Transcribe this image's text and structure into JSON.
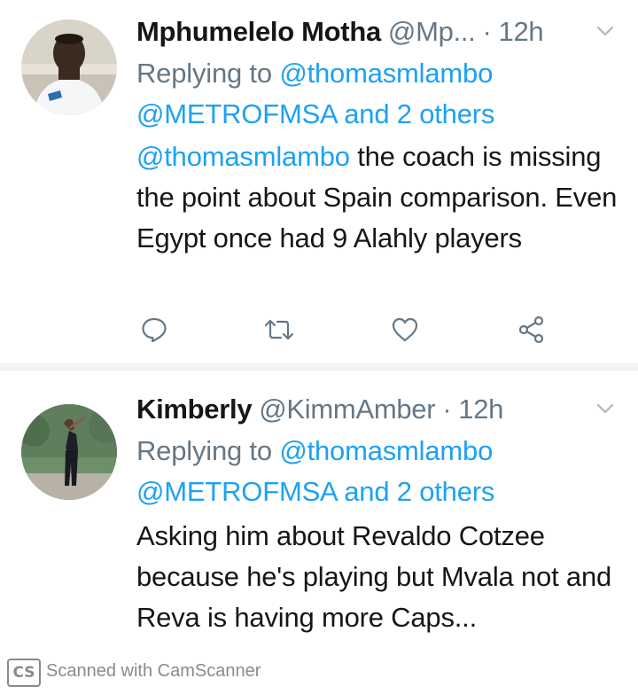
{
  "tweets": [
    {
      "name": "Mphumelelo Motha",
      "handle": "@Mp...",
      "dot": "·",
      "time": "12h",
      "replying_prefix": "Replying to",
      "mention_1": "@thomasmlambo",
      "mention_2": "@METROFMSA",
      "and_others": "and 2 others",
      "text_mention": "@thomasmlambo",
      "text": " the coach is missing the point about Spain comparison. Even Egypt once had 9 Alahly players",
      "icons": [
        "reply-icon",
        "retweet-icon",
        "like-icon",
        "share-icon"
      ]
    },
    {
      "name": "Kimberly",
      "handle": "@KimmAmber",
      "dot": "·",
      "time": "12h",
      "replying_prefix": "Replying to",
      "mention_1": "@thomasmlambo",
      "mention_2": "@METROFMSA",
      "and_others": "and 2 others",
      "text": "Asking him about Revaldo Cotzee because he's playing but Mvala not and Reva is having more Caps..."
    }
  ],
  "footer": {
    "logo": "CS",
    "text": "Scanned with CamScanner"
  },
  "colors": {
    "link": "#1da1f2",
    "secondary_text": "#657786",
    "primary_text": "#14171a",
    "icon": "#657786"
  }
}
